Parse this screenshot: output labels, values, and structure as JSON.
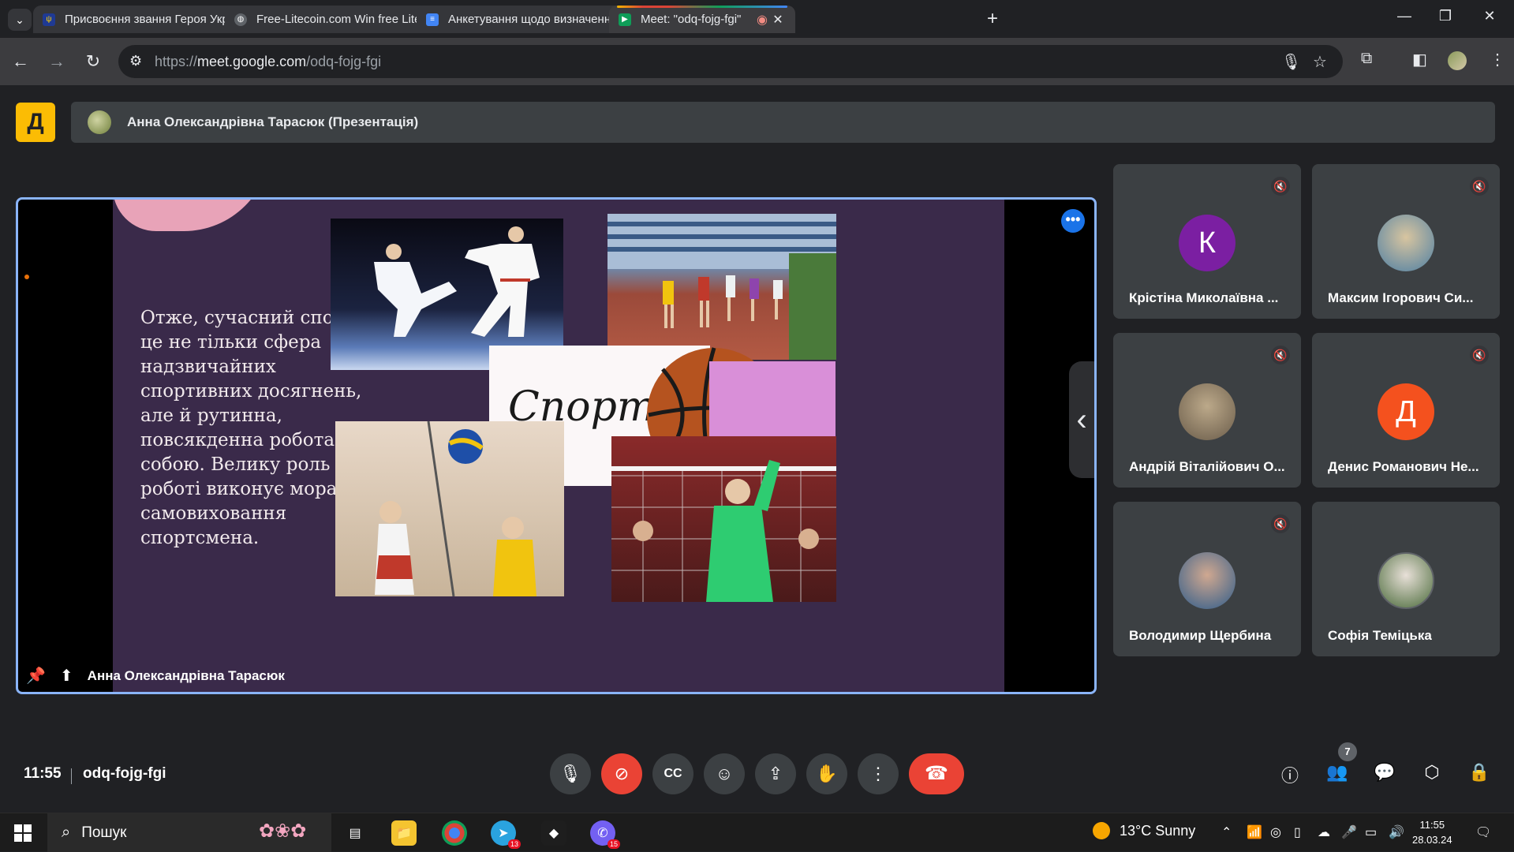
{
  "browser": {
    "tabs": [
      {
        "title": "Присвоєння звання Героя Укр",
        "favicon": "ukraine-trident-icon",
        "fav_color": "#1f3a93"
      },
      {
        "title": "Free-Litecoin.com Win free Lite",
        "favicon": "globe-icon",
        "fav_color": "#5f6368"
      },
      {
        "title": "Анкетування щодо визначенн",
        "favicon": "google-forms-icon",
        "fav_color": "#4285f4"
      },
      {
        "title": "Meet: \"odq-fojg-fgi\"",
        "favicon": "google-meet-icon",
        "fav_color": "#0f9d58"
      }
    ],
    "url_prefix": "https://",
    "url_host": "meet.google.com",
    "url_path": "/odq-fojg-fgi"
  },
  "meet": {
    "presenter_banner": "Анна Олександрівна Тарасюк (Презентація)",
    "presenter_name": "Анна Олександрівна Тарасюк",
    "slide": {
      "text": "Отже, сучасний спорт – це не тільки сфера надзвичайних спортивних досягнень, але й рутинна, повсякденна робота над собою. Велику роль у цій роботі виконує моральне самовиховання спортсмена.",
      "center_title": "Спорт"
    },
    "participants": [
      {
        "name": "Крістіна Миколаївна ...",
        "initial": "К",
        "color": "#7b1fa2",
        "muted": true
      },
      {
        "name": "Максим Ігорович Си...",
        "initial": "",
        "color": "#4e7fa3",
        "muted": true
      },
      {
        "name": "Андрій Віталійович О...",
        "initial": "",
        "color": "#6a5c4a",
        "muted": true
      },
      {
        "name": "Денис Романович Не...",
        "initial": "Д",
        "color": "#f4511e",
        "muted": true
      },
      {
        "name": "Володимир Щербина",
        "initial": "",
        "color": "#2f5c8a",
        "muted": true
      },
      {
        "name": "Софія Теміцька",
        "initial": "",
        "color": "#4a6a3a",
        "muted": false
      }
    ],
    "time": "11:55",
    "code": "odq-fojg-fgi",
    "people_count": "7"
  },
  "taskbar": {
    "search_placeholder": "Пошук",
    "weather": "13°C  Sunny",
    "time": "11:55",
    "date": "28.03.24",
    "telegram_badge": "13",
    "viber_badge": "15"
  }
}
